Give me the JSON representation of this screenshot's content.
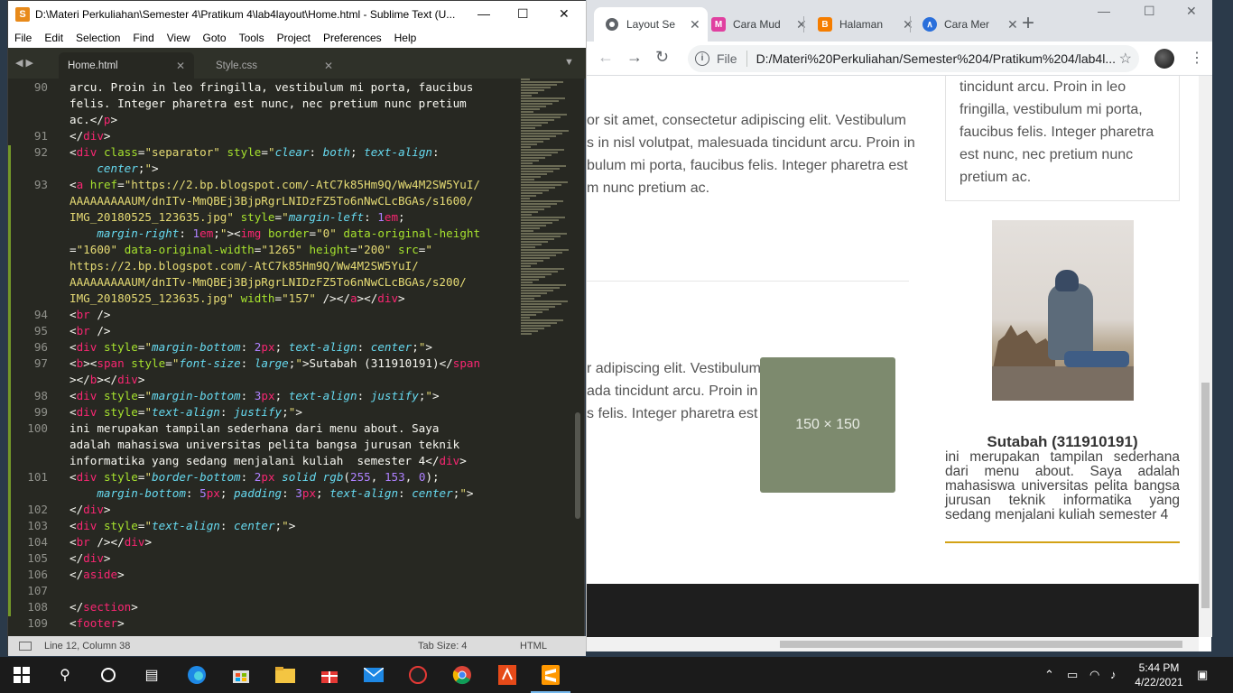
{
  "chrome": {
    "tabs": [
      {
        "label": "Layout Se",
        "icon": "globe-icon",
        "color": "#5f6368"
      },
      {
        "label": "Cara Mud",
        "icon": "medium-icon",
        "color": "#e040a0"
      },
      {
        "label": "Halaman",
        "icon": "blogger-icon",
        "color": "#f57d00"
      },
      {
        "label": "Cara Mer",
        "icon": "app-icon",
        "color": "#2a6fdb"
      }
    ],
    "new_tab": "+",
    "minimize": "—",
    "maximize": "☐",
    "close": "✕",
    "info": "i",
    "file_label": "File",
    "url": "D:/Materi%20Perkuliahan/Semester%204/Pratikum%204/lab4l...",
    "page": {
      "lorem_top": "or sit amet, consectetur adipiscing elit. Vestibulum\ns in nisl volutpat, malesuada tincidunt arcu. Proin in\nbulum mi porta, faucibus felis. Integer pharetra est\nm nunc pretium ac.",
      "lorem_bottom": "r adipiscing elit. Vestibulum\nada tincidunt arcu. Proin in\ns felis. Integer pharetra est",
      "placeholder": "150 × 150",
      "card_text": "tincidunt arcu. Proin in leo\nfringilla, vestibulum mi porta,\nfaucibus felis. Integer pharetra\nest nunc, nec pretium nunc\npretium ac.",
      "name": "Sutabah (311910191)",
      "about": "ini merupakan tampilan sederhana dari menu about. Saya adalah mahasiswa universitas pelita bangsa jurusan teknik informatika yang sedang menjalani kuliah semester 4",
      "accent": "#d3a216"
    }
  },
  "sublime": {
    "title": "D:\\Materi Perkuliahan\\Semester 4\\Pratikum 4\\lab4layout\\Home.html - Sublime Text (U...",
    "menu": [
      "File",
      "Edit",
      "Selection",
      "Find",
      "View",
      "Goto",
      "Tools",
      "Project",
      "Preferences",
      "Help"
    ],
    "tabs": [
      "Home.html",
      "Style.css"
    ],
    "status_left": "Line 12, Column 38",
    "status_tab": "Tab Size: 4",
    "status_syntax": "HTML",
    "lines": [
      {
        "n": "90",
        "html": "<span>arcu. Proin in leo fringilla, vestibulum mi porta, faucibus</span>"
      },
      {
        "n": "",
        "html": "felis. Integer pharetra est nunc, nec pretium nunc pretium"
      },
      {
        "n": "",
        "html": "ac.&lt;/<span class='tg'>p</span>&gt;"
      },
      {
        "n": "91",
        "html": "&lt;/<span class='tg'>div</span>&gt;"
      },
      {
        "n": "92",
        "html": "&lt;<span class='tg'>div</span> <span class='at'>class</span>=<span class='st'>\"separator\"</span> <span class='at'>style</span>=<span class='st'>\"</span><span class='pr'>clear</span>: <span class='pr'>both</span>; <span class='pr'>text-align</span>:"
      },
      {
        "n": "",
        "html": "    <span class='pr'>center</span>;<span class='st'>\"</span>&gt;"
      },
      {
        "n": "93",
        "html": "&lt;<span class='tg'>a</span> <span class='at'>href</span>=<span class='st'>\"https://2.bp.blogspot.com/-AtC7k85Hm9Q/Ww4M2SW5YuI/</span>"
      },
      {
        "n": "",
        "html": "<span class='st'>AAAAAAAAAUM/dnITv-MmQBEj3BjpRgrLNIDzFZ5To6nNwCLcBGAs/s1600/</span>"
      },
      {
        "n": "",
        "html": "<span class='st'>IMG_20180525_123635.jpg\"</span> <span class='at'>style</span>=<span class='st'>\"</span><span class='pr'>margin-left</span>: <span class='nm'>1</span><span class='tg'>em</span>;"
      },
      {
        "n": "",
        "html": "    <span class='pr'>margin-right</span>: <span class='nm'>1</span><span class='tg'>em</span>;<span class='st'>\"</span>&gt;&lt;<span class='tg'>img</span> <span class='at'>border</span>=<span class='st'>\"0\"</span> <span class='at'>data-original-height</span>"
      },
      {
        "n": "",
        "html": "=<span class='st'>\"1600\"</span> <span class='at'>data-original-width</span>=<span class='st'>\"1265\"</span> <span class='at'>height</span>=<span class='st'>\"200\"</span> <span class='at'>src</span>=<span class='st'>\"</span>"
      },
      {
        "n": "",
        "html": "<span class='st'>https://2.bp.blogspot.com/-AtC7k85Hm9Q/Ww4M2SW5YuI/</span>"
      },
      {
        "n": "",
        "html": "<span class='st'>AAAAAAAAAUM/dnITv-MmQBEj3BjpRgrLNIDzFZ5To6nNwCLcBGAs/s200/</span>"
      },
      {
        "n": "",
        "html": "<span class='st'>IMG_20180525_123635.jpg\"</span> <span class='at'>width</span>=<span class='st'>\"157\"</span> /&gt;&lt;/<span class='tg'>a</span>&gt;&lt;/<span class='tg'>div</span>&gt;"
      },
      {
        "n": "94",
        "html": "&lt;<span class='tg'>br</span> /&gt;"
      },
      {
        "n": "95",
        "html": "&lt;<span class='tg'>br</span> /&gt;"
      },
      {
        "n": "96",
        "html": "&lt;<span class='tg'>div</span> <span class='at'>style</span>=<span class='st'>\"</span><span class='pr'>margin-bottom</span>: <span class='nm'>2</span><span class='tg'>px</span>; <span class='pr'>text-align</span>: <span class='pr'>center</span>;<span class='st'>\"</span>&gt;"
      },
      {
        "n": "97",
        "html": "&lt;<span class='tg'>b</span>&gt;&lt;<span class='tg'>span</span> <span class='at'>style</span>=<span class='st'>\"</span><span class='pr'>font-size</span>: <span class='pr'>large</span>;<span class='st'>\"</span>&gt;Sutabah (311910191)&lt;/<span class='tg'>span</span>"
      },
      {
        "n": "",
        "html": "&gt;&lt;/<span class='tg'>b</span>&gt;&lt;/<span class='tg'>div</span>&gt;"
      },
      {
        "n": "98",
        "html": "&lt;<span class='tg'>div</span> <span class='at'>style</span>=<span class='st'>\"</span><span class='pr'>margin-bottom</span>: <span class='nm'>3</span><span class='tg'>px</span>; <span class='pr'>text-align</span>: <span class='pr'>justify</span>;<span class='st'>\"</span>&gt;"
      },
      {
        "n": "99",
        "html": "&lt;<span class='tg'>div</span> <span class='at'>style</span>=<span class='st'>\"</span><span class='pr'>text-align</span>: <span class='pr'>justify</span>;<span class='st'>\"</span>&gt;"
      },
      {
        "n": "100",
        "html": "ini merupakan tampilan sederhana dari menu about. Saya"
      },
      {
        "n": "",
        "html": "adalah mahasiswa universitas pelita bangsa jurusan teknik"
      },
      {
        "n": "",
        "html": "informatika yang sedang menjalani kuliah  semester 4&lt;/<span class='tg'>div</span>&gt;"
      },
      {
        "n": "101",
        "html": "&lt;<span class='tg'>div</span> <span class='at'>style</span>=<span class='st'>\"</span><span class='pr'>border-bottom</span>: <span class='nm'>2</span><span class='tg'>px</span> <span class='pr'>solid</span> <span class='pr'>rgb</span>(<span class='nm'>255</span>, <span class='nm'>153</span>, <span class='nm'>0</span>);"
      },
      {
        "n": "",
        "html": "    <span class='pr'>margin-bottom</span>: <span class='nm'>5</span><span class='tg'>px</span>; <span class='pr'>padding</span>: <span class='nm'>3</span><span class='tg'>px</span>; <span class='pr'>text-align</span>: <span class='pr'>center</span>;<span class='st'>\"</span>&gt;"
      },
      {
        "n": "102",
        "html": "&lt;/<span class='tg'>div</span>&gt;"
      },
      {
        "n": "103",
        "html": "&lt;<span class='tg'>div</span> <span class='at'>style</span>=<span class='st'>\"</span><span class='pr'>text-align</span>: <span class='pr'>center</span>;<span class='st'>\"</span>&gt;"
      },
      {
        "n": "104",
        "html": "&lt;<span class='tg'>br</span> /&gt;&lt;/<span class='tg'>div</span>&gt;"
      },
      {
        "n": "105",
        "html": "&lt;/<span class='tg'>div</span>&gt;"
      },
      {
        "n": "106",
        "html": "&lt;/<span class='tg'>aside</span>&gt;"
      },
      {
        "n": "107",
        "html": ""
      },
      {
        "n": "108",
        "html": "&lt;/<span class='tg'>section</span>&gt;"
      },
      {
        "n": "109",
        "html": "&lt;<span class='tg'>footer</span>&gt;"
      }
    ]
  },
  "taskbar": {
    "apps": [
      "windows-start-icon",
      "search-icon",
      "cortana-icon",
      "task-view-icon",
      "edge-icon",
      "store-icon",
      "file-explorer-icon",
      "gift-icon",
      "mail-icon",
      "game-icon",
      "chrome-icon",
      "pdf-icon",
      "sublime-icon"
    ],
    "time": "5:44 PM",
    "date": "4/22/2021"
  }
}
